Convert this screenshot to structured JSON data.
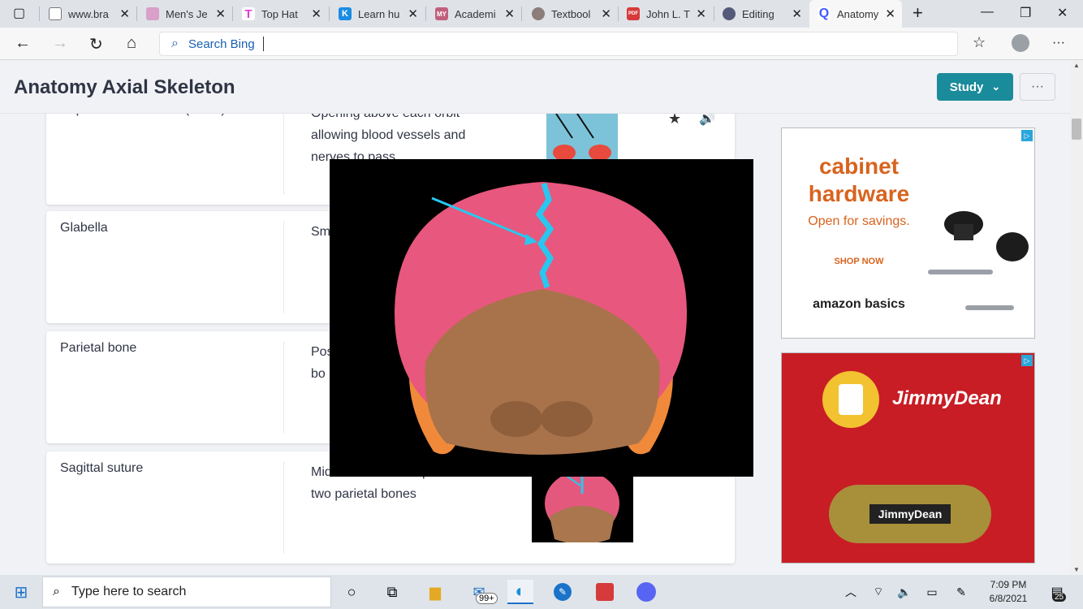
{
  "browser": {
    "tabs": [
      {
        "title": "www.bra",
        "fav_color": "#777777",
        "fav_char": ""
      },
      {
        "title": "Men's Je",
        "fav_color": "#d9a0c9",
        "fav_char": ""
      },
      {
        "title": "Top Hat",
        "fav_color": "#e23fd1",
        "fav_char": "T"
      },
      {
        "title": "Learn hu",
        "fav_color": "#1b8ce3",
        "fav_char": "K"
      },
      {
        "title": "Academi",
        "fav_color": "#c0607d",
        "fav_char": "MY"
      },
      {
        "title": "Textbool",
        "fav_color": "#8a7d7a",
        "fav_char": ""
      },
      {
        "title": "John L. T",
        "fav_color": "#d63a3a",
        "fav_char": "PDF"
      },
      {
        "title": "Editing",
        "fav_color": "#555a7a",
        "fav_char": ""
      },
      {
        "title": "Anatomy",
        "fav_color": "#4257ff",
        "fav_char": "Q"
      }
    ],
    "address_placeholder": "Search Bing"
  },
  "page": {
    "title": "Anatomy Axial Skeleton",
    "study_label": "Study",
    "more_label": "···"
  },
  "cards": [
    {
      "term": "Supraorbital foramen (notch)",
      "definition": "Opening above each orbit allowing blood vessels and nerves to pass"
    },
    {
      "term": "Glabella",
      "definition": "Sm"
    },
    {
      "term": "Parietal bone",
      "definition": "Pos bo"
    },
    {
      "term": "Sagittal suture",
      "definition": "Midline articulation point of the two parietal bones"
    }
  ],
  "ads": {
    "ad1": {
      "headline": "cabinet hardware",
      "sub": "Open for savings.",
      "cta": "SHOP NOW",
      "brand": "amazon basics"
    },
    "ad2": {
      "brand": "JimmyDean",
      "product": "JimmyDean"
    }
  },
  "taskbar": {
    "search_placeholder": "Type here to search",
    "mail_badge": "99+",
    "time": "7:09 PM",
    "date": "6/8/2021",
    "notifications": "25"
  }
}
